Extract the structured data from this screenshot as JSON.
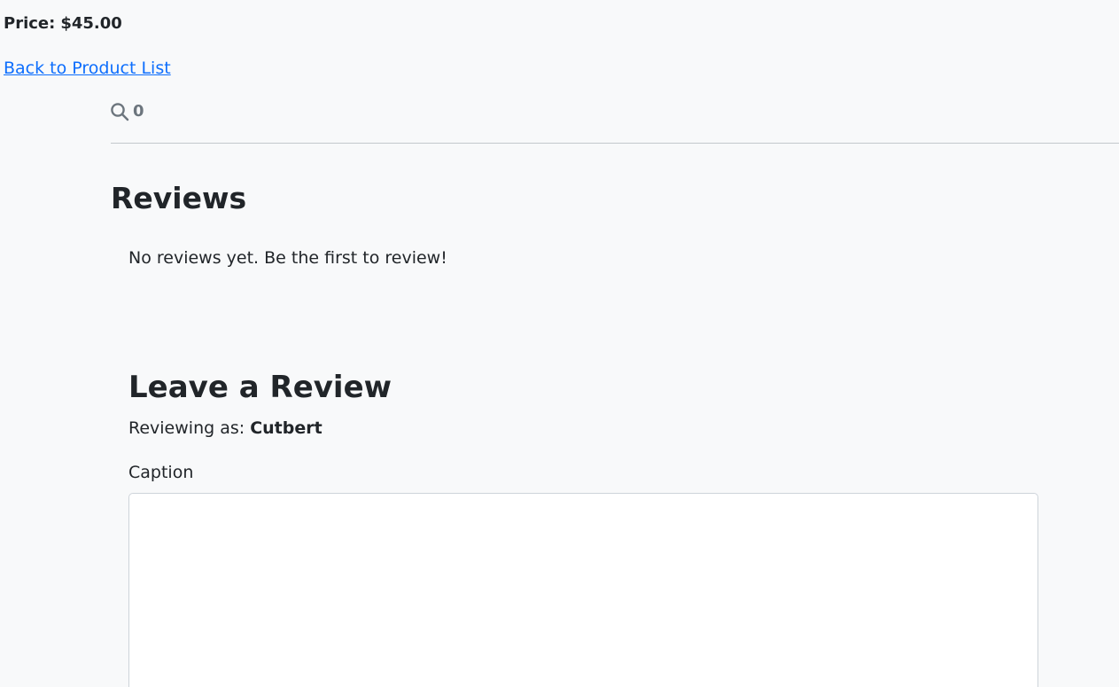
{
  "product": {
    "price_label": "Price:",
    "price_value": "$45.00"
  },
  "navigation": {
    "back_link": "Back to Product List"
  },
  "search_widget": {
    "icon": "search-icon",
    "count": "0"
  },
  "reviews": {
    "heading": "Reviews",
    "empty_message": "No reviews yet. Be the first to review!"
  },
  "review_form": {
    "heading": "Leave a Review",
    "reviewing_as_label": "Reviewing as:",
    "username": "Cutbert",
    "caption_label": "Caption",
    "caption_value": "",
    "caption_placeholder": ""
  },
  "colors": {
    "background": "#f8f9fa",
    "text": "#212529",
    "link": "#0d6efd",
    "muted": "#6c757d",
    "border": "#ced4da"
  }
}
